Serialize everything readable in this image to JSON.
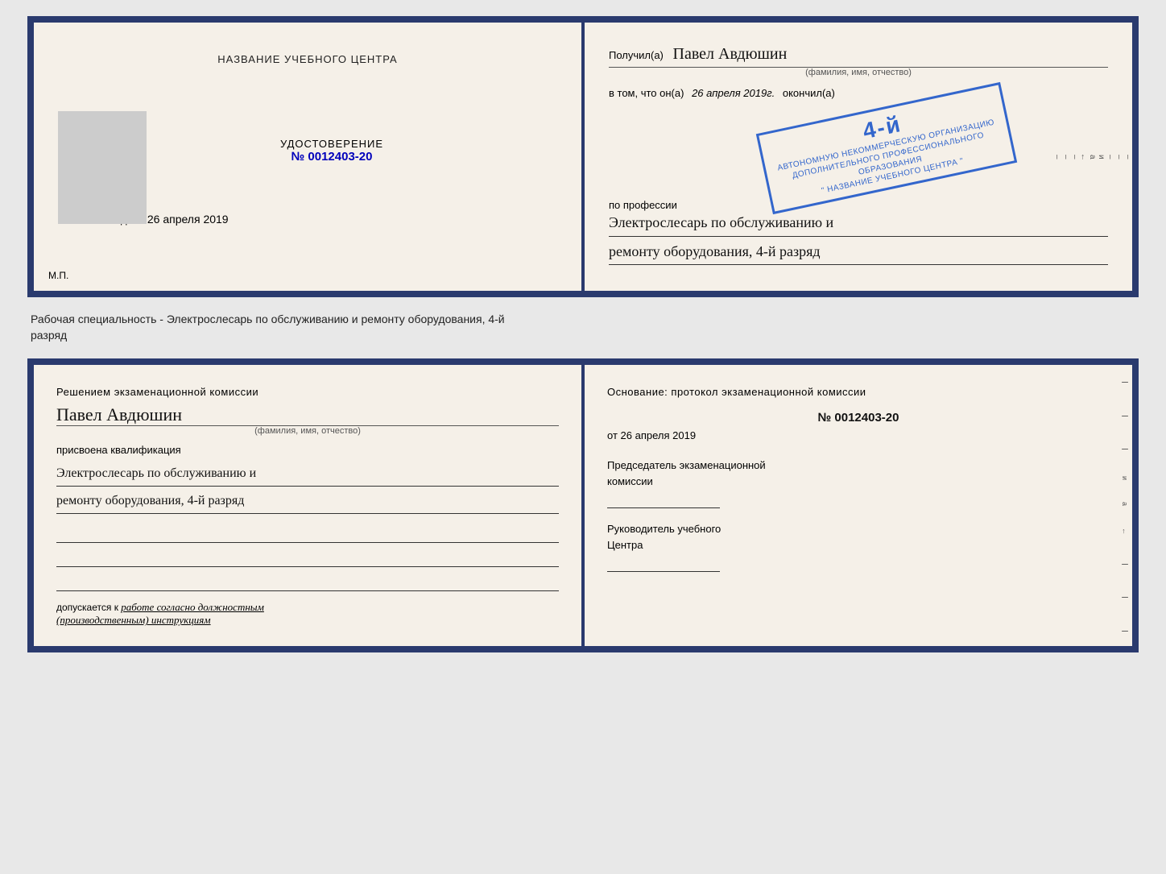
{
  "top_doc": {
    "left": {
      "center_title": "НАЗВАНИЕ УЧЕБНОГО ЦЕНТРА",
      "cert_label": "УДОСТОВЕРЕНИЕ",
      "cert_number_prefix": "№",
      "cert_number": "0012403-20",
      "issued_label": "Выдано",
      "issued_date": "26 апреля 2019",
      "mp_label": "М.П."
    },
    "right": {
      "received_prefix": "Получил(а)",
      "recipient_name": "Павел Авдюшин",
      "name_subtitle": "(фамилия, имя, отчество)",
      "body_line1_prefix": "в том, что он(а)",
      "body_date": "26 апреля 2019г.",
      "body_finished": "окончил(а)",
      "stamp_grade": "4-й",
      "stamp_line1": "АВТОНОМНУЮ НЕКОММЕРЧЕСКУЮ ОРГАНИЗАЦИЮ",
      "stamp_line2": "ДОПОЛНИТЕЛЬНОГО ПРОФЕССИОНАЛЬНОГО ОБРАЗОВАНИЯ",
      "stamp_line3": "\" НАЗВАНИЕ УЧЕБНОГО ЦЕНТРА \"",
      "profession_label": "по профессии",
      "profession_line1": "Электрослесарь по обслуживанию и",
      "profession_line2": "ремонту оборудования, 4-й разряд",
      "edge_chars": [
        "–",
        "–",
        "–",
        "и",
        "а",
        "←",
        "–",
        "–",
        "–"
      ]
    }
  },
  "middle_label": {
    "text_line1": "Рабочая специальность - Электрослесарь по обслуживанию и ремонту оборудования, 4-й",
    "text_line2": "разряд"
  },
  "bottom_doc": {
    "left": {
      "decision_text": "Решением экзаменационной  комиссии",
      "person_name": "Павел Авдюшин",
      "name_subtitle": "(фамилия, имя, отчество)",
      "assigned_label": "присвоена квалификация",
      "profession_line1": "Электрослесарь по обслуживанию и",
      "profession_line2": "ремонту оборудования, 4-й разряд",
      "допуск_prefix": "допускается к",
      "допуск_text": "работе согласно должностным",
      "допуск_text2": "(производственным) инструкциям"
    },
    "right": {
      "basis_text": "Основание: протокол экзаменационной  комиссии",
      "number_prefix": "№",
      "number_value": "0012403-20",
      "date_prefix": "от",
      "date_value": "26 апреля 2019",
      "chairman_title_line1": "Председатель экзаменационной",
      "chairman_title_line2": "комиссии",
      "director_title_line1": "Руководитель учебного",
      "director_title_line2": "Центра",
      "edge_chars": [
        "–",
        "–",
        "–",
        "и",
        "а",
        "←",
        "–",
        "–",
        "–"
      ]
    }
  }
}
